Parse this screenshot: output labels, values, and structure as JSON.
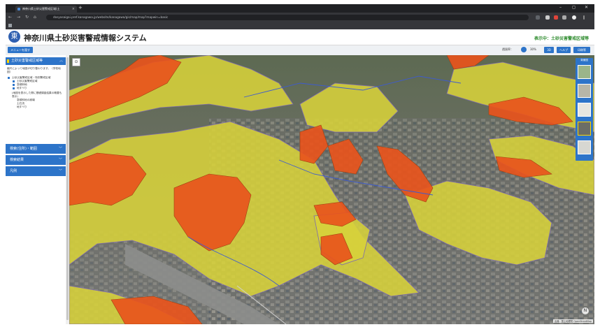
{
  "browser": {
    "tab_title": "神奈川県土砂災害警戒区域(土",
    "new_tab": "+",
    "url": "dosyasaigai.pref.kanagawa.jp/website/kanagawa/gis/map/map?mapwin=basic",
    "win_min": "–",
    "win_max": "◻",
    "win_close": "✕"
  },
  "app": {
    "logo_char": "東",
    "title": "神奈川県土砂災害警戒情報システム",
    "display_label": "表示中：土砂災害警戒区域等"
  },
  "toolbar": {
    "menu_label": "メニューを隠す",
    "transparency_label": "透過率：",
    "transparency_value": "30%",
    "btn_3d": "3D",
    "btn_help": "ヘルプ",
    "btn_print": "印刷等"
  },
  "sidebar": {
    "section_title": "土砂災害警戒区域等",
    "description": "縮尺によって地図が切り替わります。（学校地図）",
    "items": [
      {
        "label": "土砂災害警戒区域・特別警戒区域",
        "level": 0
      },
      {
        "label": "土砂災害警戒区域",
        "level": 1
      },
      {
        "label": "急傾斜地",
        "level": 1
      },
      {
        "label": "地すべり",
        "level": 1
      }
    ],
    "note": "(地図を表示した際に基礎調査結果の概要も表示)",
    "sub_notes": [
      "急傾斜地の崩壊",
      "土石流",
      "地すべり"
    ],
    "accordions": [
      {
        "label": "検索(住所)・範囲"
      },
      {
        "label": "検索結果"
      },
      {
        "label": "凡例"
      }
    ]
  },
  "map": {
    "tool_icon": "⊙",
    "bg_title": "背景図",
    "bg_thumbs": [
      "地図",
      "航空",
      "標準",
      "地形",
      "淡色"
    ],
    "compass": "N",
    "attribution": "出典：国土地理院 OpenStreetMap"
  },
  "colors": {
    "accent": "#2d74c9",
    "special_zone": "#e8541c",
    "warning_zone": "#d7d23a"
  }
}
